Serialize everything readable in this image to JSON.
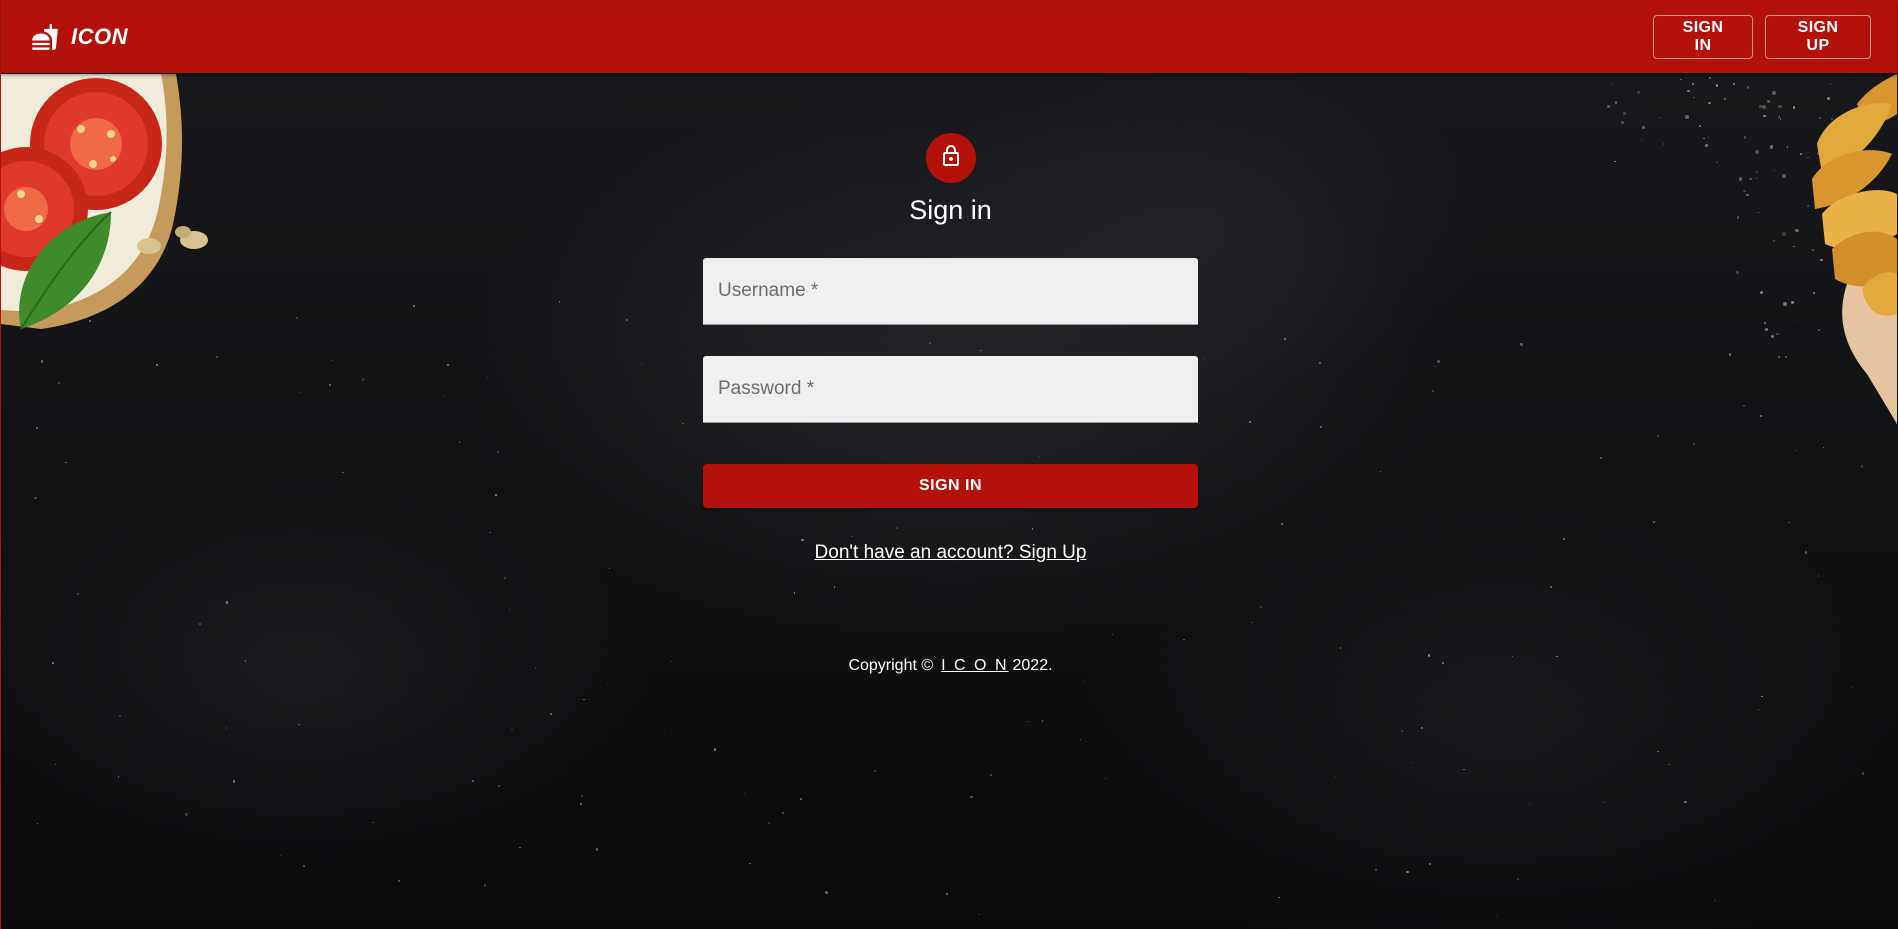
{
  "header": {
    "brand_name": "ICON",
    "brand_icon": "fastfood-icon",
    "signin_label": "SIGN IN",
    "signup_label": "SIGN UP"
  },
  "form": {
    "lock_icon": "lock-icon",
    "title": "Sign in",
    "username_placeholder": "Username *",
    "password_placeholder": "Password *",
    "submit_label": "SIGN IN",
    "signup_link": "Don't have an account? Sign Up"
  },
  "footer": {
    "copyright_prefix": "Copyright ©",
    "brand_link": "I C O N",
    "year_suffix": "2022."
  },
  "colors": {
    "primary": "#b4110c",
    "background": "#0c0d0f",
    "field_bg": "#efefef"
  }
}
